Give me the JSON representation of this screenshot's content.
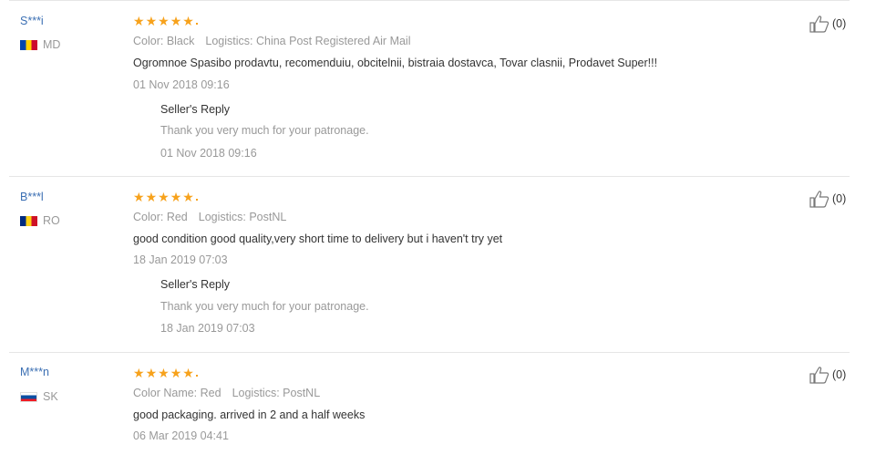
{
  "reviews": [
    {
      "user": "S***i",
      "country": "MD",
      "flag_colors": [
        "#0046ae",
        "#ffd200",
        "#cc092f"
      ],
      "stars": 5,
      "color_label": "Color: Black",
      "logistics_label": "Logistics: China Post Registered Air Mail",
      "text": "Ogromnoe Spasibo prodavtu, recomenduiu, obcitelnii, bistraia dostavca, Tovar clasnii, Prodavet Super!!!",
      "date": "01 Nov 2018 09:16",
      "reply_title": "Seller's Reply",
      "reply_text": "Thank you very much for your patronage.",
      "reply_date": "01 Nov 2018 09:16",
      "likes": "(0)"
    },
    {
      "user": "B***l",
      "country": "RO",
      "flag_colors": [
        "#002b7f",
        "#fcd116",
        "#ce1126"
      ],
      "stars": 5,
      "color_label": "Color: Red",
      "logistics_label": "Logistics: PostNL",
      "text": "good condition good quality,very short time to delivery but i haven't try yet",
      "date": "18 Jan 2019 07:03",
      "reply_title": "Seller's Reply",
      "reply_text": "Thank you very much for your patronage.",
      "reply_date": "18 Jan 2019 07:03",
      "likes": "(0)"
    },
    {
      "user": "M***n",
      "country": "SK",
      "flag_colors": [
        "#ffffff",
        "#0b4ea2",
        "#ee1c25"
      ],
      "stars": 5,
      "color_label": "Color Name: Red",
      "logistics_label": "Logistics: PostNL",
      "text": "good packaging. arrived in 2 and a half weeks",
      "date": "06 Mar 2019 04:41",
      "likes": "(0)"
    }
  ]
}
